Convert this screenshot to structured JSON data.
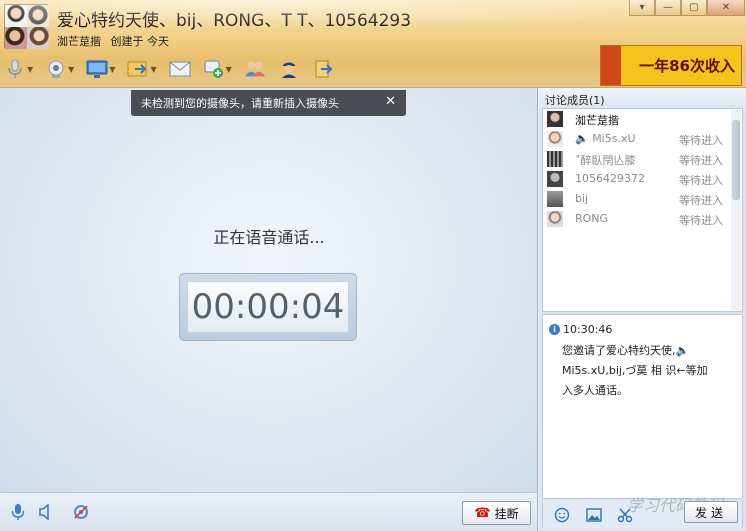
{
  "header": {
    "title": "爱心特约天使、bij、RONG、T T、10564293",
    "creator": "洳芒莡揩",
    "created": "创建于 今天",
    "ad_text": "一年86次收入"
  },
  "toolbar": {
    "items": [
      "microphone-icon",
      "camera-icon",
      "screen-share-icon",
      "file-transfer-icon",
      "email-icon",
      "add-app-icon",
      "invite-icon",
      "admin-icon",
      "exit-icon"
    ]
  },
  "main": {
    "notice": "未检测到您的摄像头，请重新插入摄像头",
    "notice_close": "✕",
    "status": "正在语音通话...",
    "timer": "00:00:04",
    "hangup": "挂断"
  },
  "members": {
    "header": "讨论成员(1)",
    "list": [
      {
        "name": "洳芒莡揩",
        "status": ""
      },
      {
        "name": "🔈 Mi5s.xU",
        "status": "等待进入"
      },
      {
        "name": "˚醉臥閇亾膝",
        "status": "等待进入"
      },
      {
        "name": "1056429372",
        "status": "等待进入"
      },
      {
        "name": "bij",
        "status": "等待进入"
      },
      {
        "name": "RONG",
        "status": "等待进入"
      }
    ]
  },
  "message": {
    "time": "10:30:46",
    "lines": [
      "您邀请了爱心特约天使,🔈",
      "Mi5s.xU,bij,づ莫 相 识←等加",
      "入多人通话。"
    ]
  },
  "send_label": "发送",
  "watermark": "学习代码教程"
}
